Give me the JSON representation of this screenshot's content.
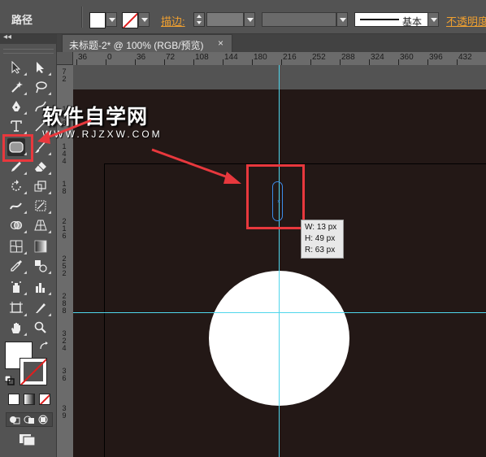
{
  "control_bar": {
    "selection_type": "路径",
    "stroke_label": "描边",
    "brush_label": "基本",
    "opacity_label": "不透明度"
  },
  "toolbox": {
    "collapse_label": "◂◂",
    "tools": [
      "selection-tool",
      "direct-selection-tool",
      "magic-wand-tool",
      "lasso-tool",
      "pen-tool",
      "curvature-tool",
      "type-tool",
      "line-segment-tool",
      "rounded-rectangle-tool",
      "paintbrush-tool",
      "pencil-tool",
      "eraser-tool",
      "rotate-tool",
      "scale-tool",
      "warp-tool",
      "free-transform-tool",
      "shape-builder-tool",
      "perspective-grid-tool",
      "mesh-tool",
      "gradient-tool",
      "eyedropper-tool",
      "blend-tool",
      "symbol-sprayer-tool",
      "column-graph-tool",
      "artboard-tool",
      "slice-tool",
      "hand-tool",
      "zoom-tool"
    ]
  },
  "document": {
    "tab_title": "未标题-2* @ 100% (RGB/预览)",
    "close_glyph": "×"
  },
  "ruler": {
    "h_labels": [
      "36",
      "0",
      "36",
      "72",
      "108",
      "144",
      "180",
      "216",
      "252",
      "288",
      "324",
      "360",
      "396",
      "432"
    ],
    "v_labels": [
      [
        "7",
        "2"
      ],
      [
        "1",
        "0",
        "8"
      ],
      [
        "1",
        "4",
        "4"
      ],
      [
        "1",
        "8"
      ],
      [
        "2",
        "1",
        "6"
      ],
      [
        "2",
        "5",
        "2"
      ],
      [
        "2",
        "8",
        "8"
      ],
      [
        "3",
        "2",
        "4"
      ],
      [
        "3",
        "6"
      ],
      [
        "3",
        "9"
      ]
    ]
  },
  "tooltip": {
    "w": "W: 13 px",
    "h": "H: 49 px",
    "r": "R: 63 px"
  },
  "watermark": {
    "title": "软件自学网",
    "url": "WWW.RJZXW.COM"
  },
  "colors": {
    "canvas_bg": "#231816",
    "guide": "#4fd6ec",
    "highlight": "#e8383d",
    "path": "#3c8be8",
    "accent_label": "#f0a030"
  }
}
